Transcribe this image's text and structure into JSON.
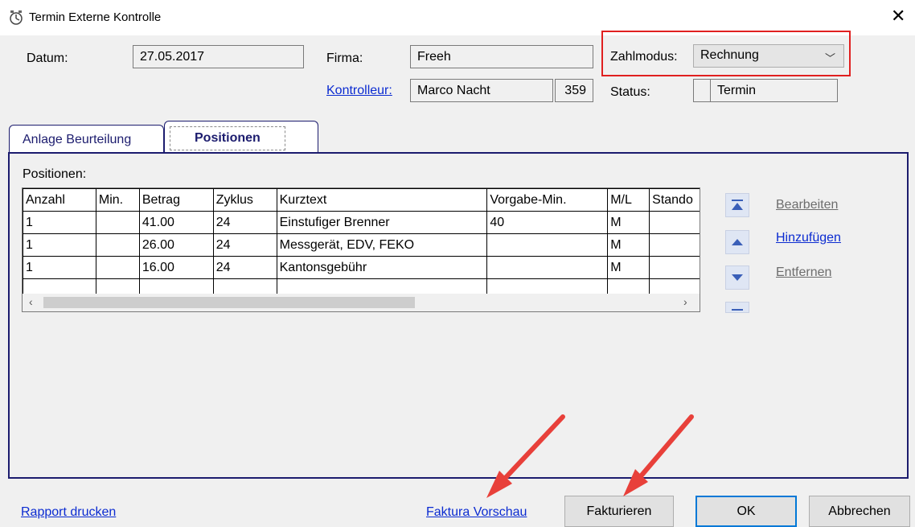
{
  "window": {
    "title": "Termin Externe Kontrolle"
  },
  "header": {
    "datum_label": "Datum:",
    "datum_value": "27.05.2017",
    "firma_label": "Firma:",
    "firma_value": "Freeh",
    "zahlmodus_label": "Zahlmodus:",
    "zahlmodus_value": "Rechnung",
    "kontrolleur_link": "Kontrolleur:",
    "kontrolleur_name": "Marco Nacht",
    "kontrolleur_id": "359",
    "status_label": "Status:",
    "status_value": "Termin"
  },
  "tabs": [
    {
      "label": "Anlage Beurteilung",
      "active": false
    },
    {
      "label": "Positionen",
      "active": true
    }
  ],
  "positionen": {
    "label": "Positionen:",
    "columns": [
      "Anzahl",
      "Min.",
      "Betrag",
      "Zyklus",
      "Kurztext",
      "Vorgabe-Min.",
      "M/L",
      "Stando"
    ],
    "rows": [
      [
        "1",
        "",
        "41.00",
        "24",
        "Einstufiger Brenner",
        "40",
        "M",
        ""
      ],
      [
        "1",
        "",
        "26.00",
        "24",
        "Messgerät, EDV, FEKO",
        "",
        "M",
        ""
      ],
      [
        "1",
        "",
        "16.00",
        "24",
        "Kantonsgebühr",
        "",
        "M",
        ""
      ]
    ],
    "actions": {
      "bearbeiten": "Bearbeiten",
      "hinzufuegen": "Hinzufügen",
      "entfernen": "Entfernen"
    }
  },
  "footer": {
    "rapport": "Rapport drucken",
    "vorschau": "Faktura Vorschau",
    "fakturieren": "Fakturieren",
    "ok": "OK",
    "abbrechen": "Abbrechen"
  },
  "colors": {
    "highlight_box": "#e02020",
    "arrow": "#e8403a",
    "tab_border": "#1c1c6e",
    "link": "#0b2bd1"
  },
  "icons": [
    "app-icon",
    "close-icon",
    "chevron-down-icon",
    "move-top-icon",
    "move-up-icon",
    "move-down-icon",
    "move-bottom-icon"
  ]
}
